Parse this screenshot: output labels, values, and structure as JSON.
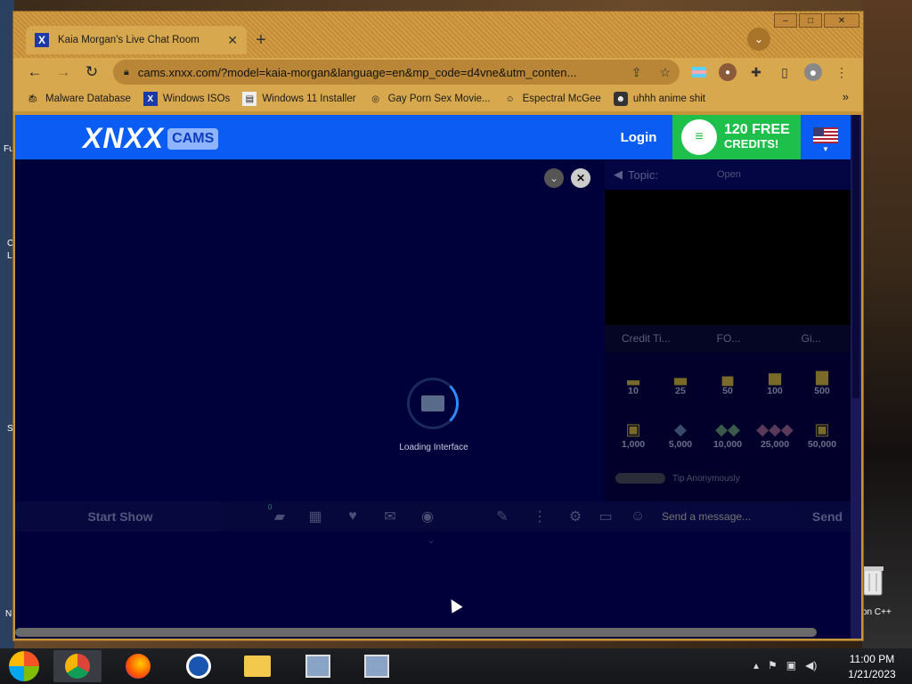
{
  "desktop": {
    "left_labels": [
      "Fu",
      "C",
      "L",
      "S",
      "N"
    ],
    "right_label": "on C++"
  },
  "browser": {
    "tab": {
      "favicon": "X",
      "title": "Kaia Morgan's Live Chat Room"
    },
    "window_controls": {
      "minimize": "–",
      "maximize": "□",
      "close": "✕"
    },
    "url": "cams.xnxx.com/?model=kaia-morgan&language=en&mp_code=d4vne&utm_conten...",
    "bookmarks": [
      {
        "label": "Malware Database",
        "icon": "bug-icon"
      },
      {
        "label": "Windows ISOs",
        "icon": "x-logo-icon"
      },
      {
        "label": "Windows 11 Installer",
        "icon": "page-icon"
      },
      {
        "label": "Gay Porn Sex Movie...",
        "icon": "globe-icon"
      },
      {
        "label": "Espectral McGee",
        "icon": "face-icon"
      },
      {
        "label": "uhhh anime shit",
        "icon": "anime-icon"
      }
    ],
    "bookmarks_more": "»"
  },
  "site": {
    "logo_main": "XNXX",
    "logo_sub": "CAMS",
    "login_label": "Login",
    "credits_line1": "120 FREE",
    "credits_line2": "CREDITS!",
    "loading_text": "Loading Interface",
    "topic_label": "Topic:",
    "topic_status": "Open",
    "sidebar_tabs": [
      "Credit Ti...",
      "FO...",
      "Gi..."
    ],
    "tips_row1": [
      "10",
      "25",
      "50",
      "100",
      "500"
    ],
    "tips_row2": [
      "1,000",
      "5,000",
      "10,000",
      "25,000",
      "50,000"
    ],
    "anon_label": "Tip Anonymously",
    "start_show_label": "Start Show",
    "notification_count": "0",
    "message_placeholder": "Send a message...",
    "send_label": "Send"
  },
  "taskbar": {
    "time": "11:00 PM",
    "date": "1/21/2023"
  }
}
